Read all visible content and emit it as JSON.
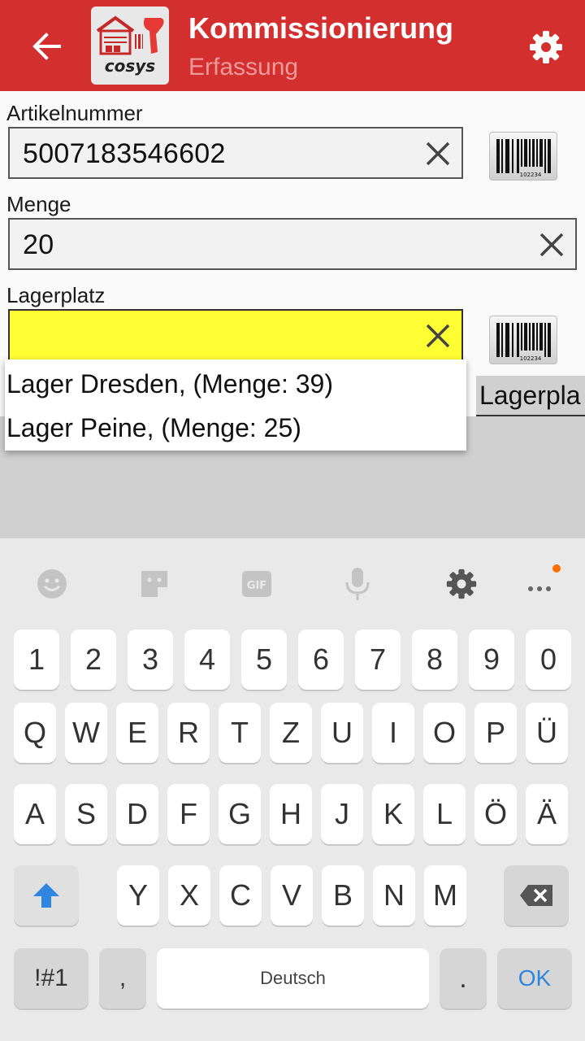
{
  "header": {
    "title": "Kommissionierung",
    "subtitle": "Erfassung",
    "logo_text": "cosys",
    "color": "#d32f2f"
  },
  "form": {
    "artikel_label": "Artikelnummer",
    "artikel_value": "5007183546602",
    "menge_label": "Menge",
    "menge_value": "20",
    "lager_label": "Lagerplatz",
    "lager_value": "",
    "lager_highlight": "#ffff33",
    "barcode_number": "102234",
    "column_header": "Lagerpla"
  },
  "dropdown": {
    "items": [
      "Lager Dresden, (Menge: 39)",
      "Lager Peine, (Menge: 25)"
    ]
  },
  "keyboard": {
    "toolbar": [
      "emoji-icon",
      "sticker-icon",
      "gif-icon",
      "microphone-icon",
      "settings-icon",
      "more-icon"
    ],
    "gif_label": "GIF",
    "row_numbers": [
      "1",
      "2",
      "3",
      "4",
      "5",
      "6",
      "7",
      "8",
      "9",
      "0"
    ],
    "row1": [
      "Q",
      "W",
      "E",
      "R",
      "T",
      "Z",
      "U",
      "I",
      "O",
      "P",
      "Ü"
    ],
    "row2": [
      "A",
      "S",
      "D",
      "F",
      "G",
      "H",
      "J",
      "K",
      "L",
      "Ö",
      "Ä"
    ],
    "row3": [
      "Y",
      "X",
      "C",
      "V",
      "B",
      "N",
      "M"
    ],
    "symbols_label": "!#1",
    "comma_label": ",",
    "space_label": "Deutsch",
    "period_label": ".",
    "ok_label": "OK",
    "ok_color": "#2f86e0"
  }
}
